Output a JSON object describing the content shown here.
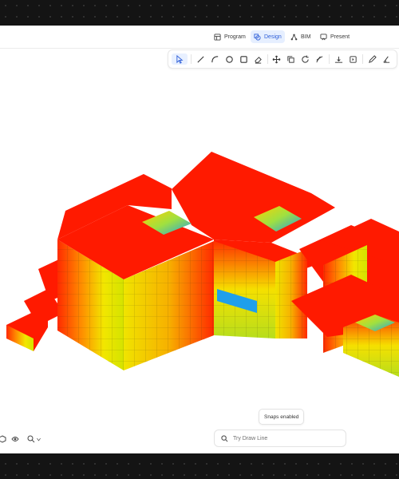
{
  "modes": [
    {
      "label": "Program",
      "icon": "table-icon",
      "active": false
    },
    {
      "label": "Design",
      "icon": "shapes-icon",
      "active": true
    },
    {
      "label": "BIM",
      "icon": "network-icon",
      "active": false
    },
    {
      "label": "Present",
      "icon": "presentation-icon",
      "active": false
    }
  ],
  "toolbar": {
    "tools": [
      "select-icon",
      "line-icon",
      "arc-icon",
      "circle-icon",
      "rectangle-icon",
      "eraser-icon",
      "move-icon",
      "copy-icon",
      "rotate-icon",
      "scale-icon",
      "align-icon",
      "mirror-icon",
      "pencil-icon",
      "angle-icon"
    ]
  },
  "snaps_label": "Snaps enabled",
  "command": {
    "placeholder": "Try Draw Line"
  },
  "colors": {
    "accent": "#2f5fd8",
    "heat_high": "#ff1a00",
    "heat_mid": "#f5e400",
    "heat_low": "#2aa8e6"
  }
}
